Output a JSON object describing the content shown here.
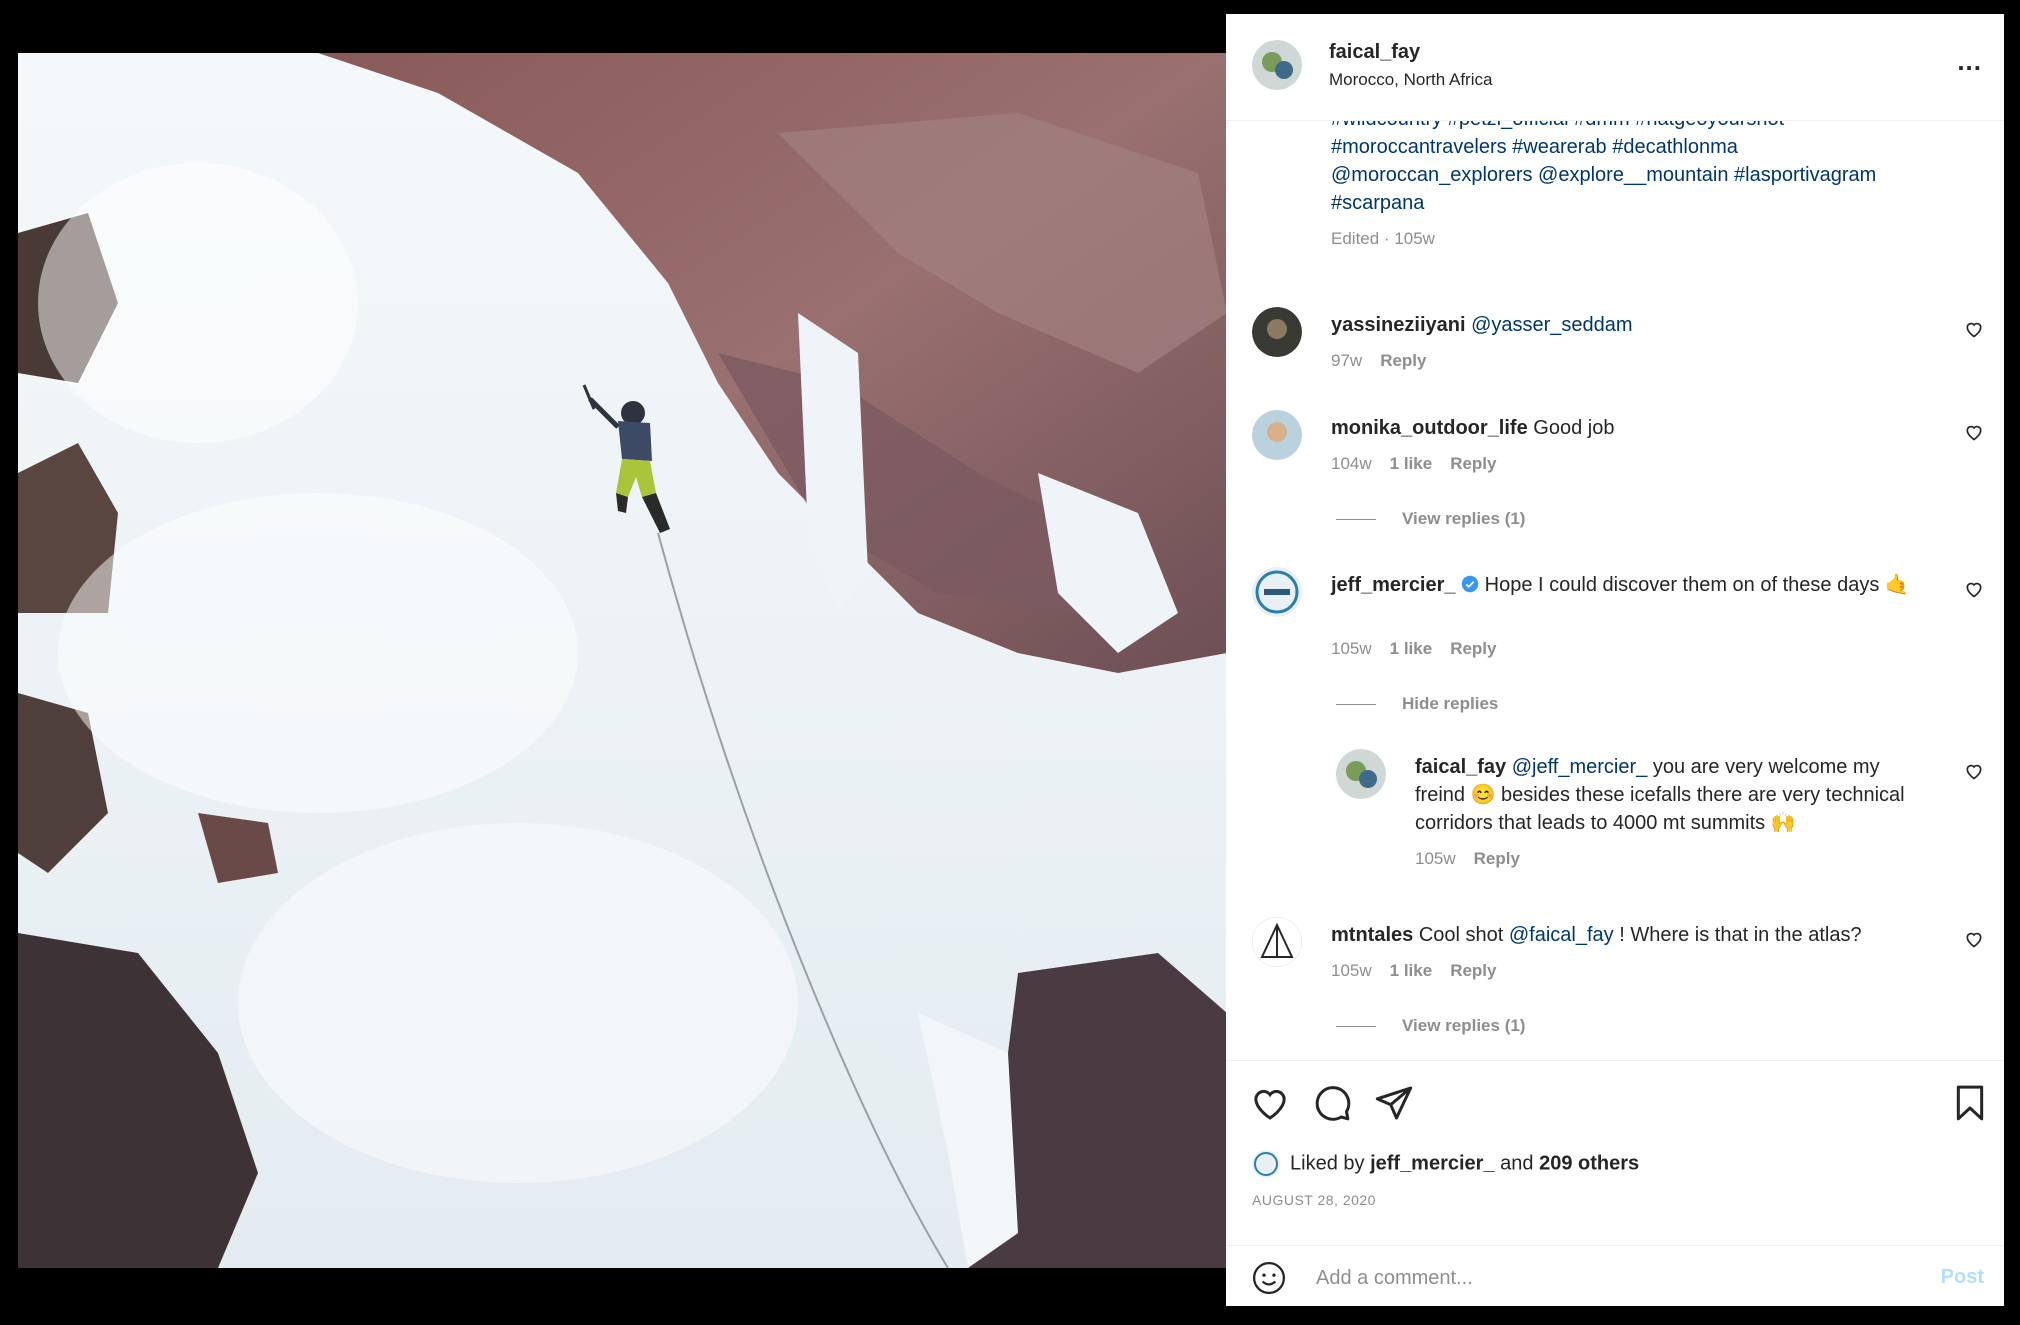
{
  "post": {
    "username": "faical_fay",
    "location": "Morocco, North Africa",
    "more_label": "...",
    "photo_icon": "ice-climbing-photo"
  },
  "caption": {
    "line1": "#wildcountry #petzl_official #dmm #natgeoyourshot",
    "line2": "#moroccantravelers #wearerab #decathlonma",
    "line3": "@moroccan_explorers @explore__mountain #lasportivagram",
    "line4": "#scarpana",
    "edited": "Edited · 105w"
  },
  "comments": [
    {
      "user": "yassineziiyani",
      "text_mention": "@yasser_seddam",
      "text": "",
      "time": "97w",
      "likes": "",
      "reply": "Reply"
    },
    {
      "user": "monika_outdoor_life",
      "text_mention": "",
      "text": "Good job",
      "time": "104w",
      "likes": "1 like",
      "reply": "Reply",
      "view_replies": "View replies (1)"
    },
    {
      "user": "jeff_mercier_",
      "text_mention": "",
      "text": "Hope I could discover them on of these days 🤙",
      "time": "105w",
      "likes": "1 like",
      "reply": "Reply",
      "hide_replies": "Hide replies",
      "verified_icon": "verified-badge-icon"
    },
    {
      "user": "mtntales",
      "text_pre": "Cool shot",
      "text_mention": "@faical_fay",
      "text": "! Where is that in the atlas?",
      "time": "105w",
      "likes": "1 like",
      "reply": "Reply",
      "view_replies": "View replies (1)"
    }
  ],
  "reply": {
    "user": "faical_fay",
    "text_mention": "@jeff_mercier_",
    "text": "you are very welcome my freind 😊 besides these icefalls there are very technical corridors that leads to 4000 mt summits 🙌",
    "time": "105w",
    "reply": "Reply"
  },
  "actions": {
    "icons": [
      "heart-icon",
      "comment-icon",
      "share-icon",
      "bookmark-icon"
    ]
  },
  "likes": {
    "prefix": "Liked by",
    "user": "jeff_mercier_",
    "and": "and",
    "others": "209 others"
  },
  "date": "AUGUST 28, 2020",
  "add_comment": {
    "placeholder": "Add a comment...",
    "post_label": "Post"
  },
  "colors": {
    "link": "#00376b",
    "muted": "#8e8e8e",
    "post_disabled": "#b2dffc",
    "verified": "#3897f0"
  }
}
